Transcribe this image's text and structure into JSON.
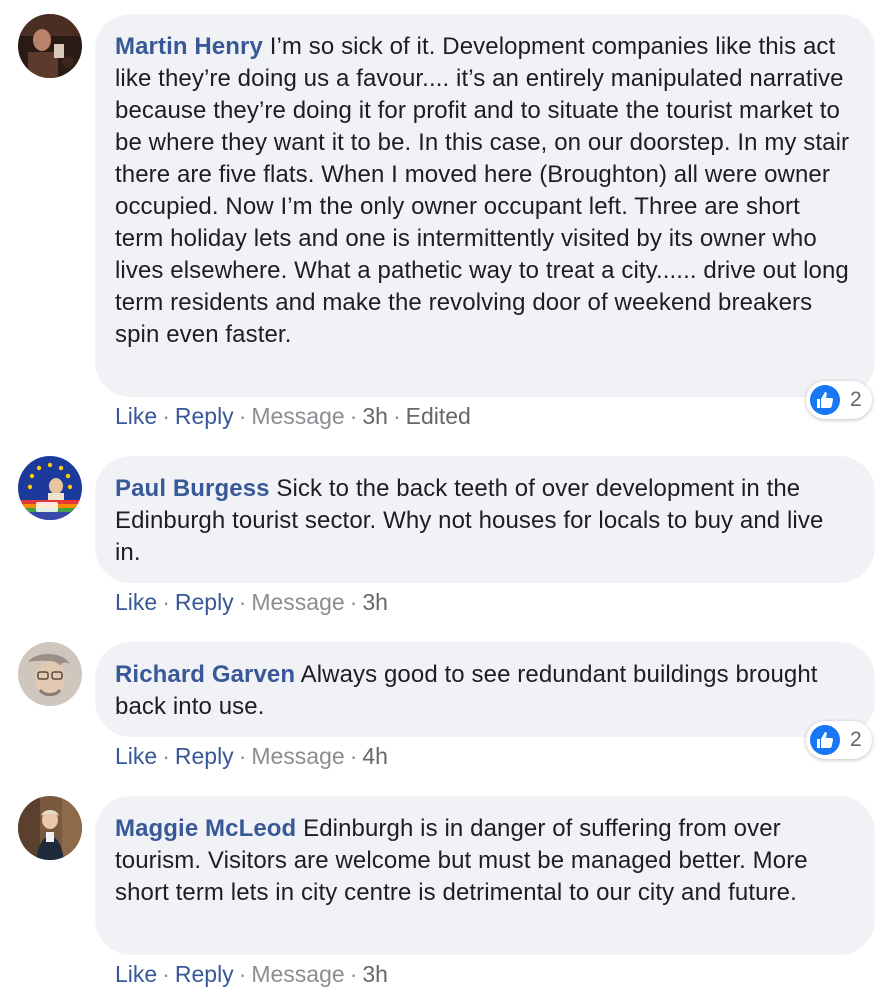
{
  "comments": [
    {
      "author": "Martin Henry",
      "text": "I’m so sick of it. Development companies like this act like they’re doing us a favour.... it’s an entirely manipulated narrative because they’re doing it for profit and to situate the tourist market to be where they want it to be. In this case, on our doorstep. In my stair there are five flats. When I moved here (Broughton) all were owner occupied. Now I’m the only owner occupant left. Three are short term holiday lets and one is intermittently visited by its owner who lives elsewhere. What a pathetic way to treat a city...... drive out long term residents and make the revolving door of weekend breakers spin even faster.",
      "like": "Like",
      "reply": "Reply",
      "message": "Message",
      "time": "3h",
      "edited": "Edited",
      "reaction_count": "2"
    },
    {
      "author": "Paul Burgess",
      "text": "Sick to the back teeth of over development in the Edinburgh tourist sector. Why not houses for locals to buy and live in.",
      "like": "Like",
      "reply": "Reply",
      "message": "Message",
      "time": "3h"
    },
    {
      "author": "Richard Garven",
      "text": "Always good to see redundant buildings brought back into use.",
      "like": "Like",
      "reply": "Reply",
      "message": "Message",
      "time": "4h",
      "reaction_count": "2"
    },
    {
      "author": "Maggie McLeod",
      "text": "Edinburgh is in danger of suffering from over tourism. Visitors are welcome but must be managed better. More short term lets in city centre is detrimental to our city and future.",
      "like": "Like",
      "reply": "Reply",
      "message": "Message",
      "time": "3h"
    }
  ],
  "separator": "·",
  "icons": {
    "reaction": "like-thumb-icon"
  },
  "colors": {
    "author": "#385898",
    "bubble": "#f0f2f5",
    "like_blue": "#1877f2"
  }
}
